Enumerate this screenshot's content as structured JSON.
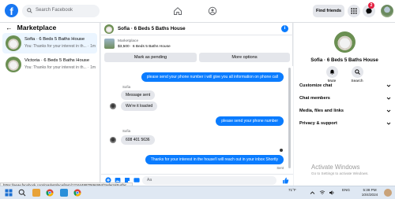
{
  "topbar": {
    "logo": "f",
    "search_placeholder": "Search Facebook",
    "find_friends": "Find friends",
    "notification_count": "2"
  },
  "sidebar": {
    "title": "Marketplace",
    "back_arrow": "←",
    "conversations": [
      {
        "title": "Sofia · 6 Beds 5 Baths House",
        "preview": "You: Thanks for your interest in th...",
        "time": "1m"
      },
      {
        "title": "Victoria · 6 Beds 5 Baths House",
        "preview": "You: Thanks for your interest in th...",
        "time": "1m"
      }
    ]
  },
  "chat": {
    "header_name": "Sofia · 6 Beds 5 Baths House",
    "info_icon": "i",
    "listing_source": "Marketplace",
    "listing_detail": "$3,500 · 6 Beds 5 Baths House",
    "mark_pending": "Mark as pending",
    "more_options": "More options",
    "messages": {
      "m1": "please send your phone number i will give you all information on phone call",
      "s1": "Sofia",
      "m2": "Message sent",
      "m3": "We're it loacted",
      "m4": "please send your phone number",
      "s2": "Sofia",
      "m5": "608 401 5636",
      "m6": "Thanks for your interest in the house!I will reach out in your inbox Shortly",
      "sent_label": "Sent"
    },
    "composer_placeholder": "Aa"
  },
  "right_panel": {
    "name": "Sofia · 6 Beds 5 Baths House",
    "mute": "Mute",
    "search": "Search",
    "rows": [
      "Customize chat",
      "Chat members",
      "Media, files and links",
      "Privacy & support"
    ]
  },
  "status_url": "https://www.facebook.com/marketplace/item/1216448870694694/?referralSurfac...",
  "watermark": {
    "title": "Activate Windows",
    "subtitle": "Go to Settings to activate Windows."
  },
  "taskbar": {
    "temp": "71°F",
    "lang": "ENG",
    "time": "5:38 PM",
    "date": "10/4/2024"
  }
}
